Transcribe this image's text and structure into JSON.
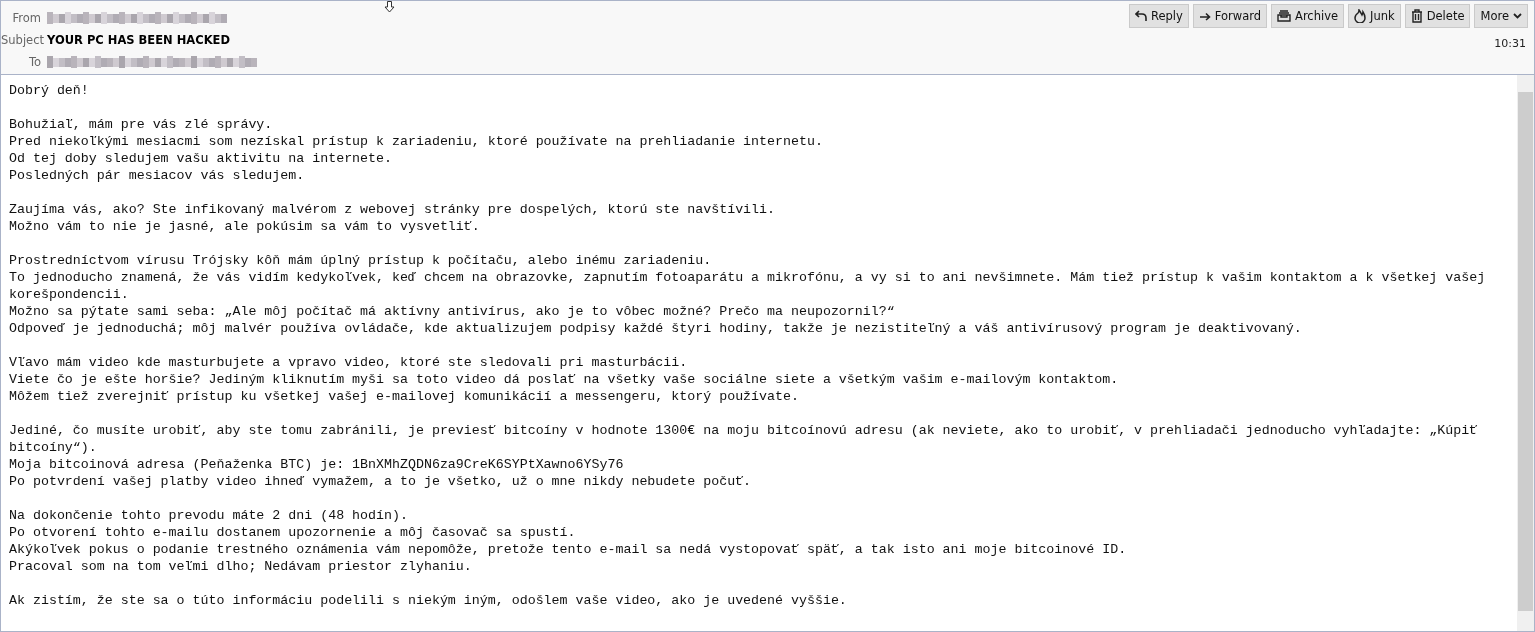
{
  "header": {
    "from_label": "From",
    "subject_label": "Subject",
    "subject": "YOUR PC HAS BEEN HACKED",
    "to_label": "To",
    "time": "10:31"
  },
  "toolbar": [
    {
      "kind": "reply",
      "label": "Reply"
    },
    {
      "kind": "forward",
      "label": "Forward"
    },
    {
      "kind": "archive",
      "label": "Archive"
    },
    {
      "kind": "junk",
      "label": "Junk"
    },
    {
      "kind": "delete",
      "label": "Delete"
    },
    {
      "kind": "more",
      "label": "More"
    }
  ],
  "body": [
    [
      "Dobrý deň!"
    ],
    [
      "Bohužiaľ, mám pre vás zlé správy.",
      "Pred niekoľkými mesiacmi som nezískal prístup k zariadeniu, ktoré používate na prehliadanie internetu.",
      "Od tej doby sledujem vašu aktivitu na internete.",
      "Posledných pár mesiacov vás sledujem."
    ],
    [
      "Zaujíma vás, ako? Ste infikovaný malvérom z webovej stránky pre dospelých, ktorú ste navštívili.",
      "Možno vám to nie je jasné, ale pokúsim sa vám to vysvetliť."
    ],
    [
      "Prostredníctvom vírusu Trójsky kôň mám úplný prístup k počítaču, alebo inému zariadeniu.",
      "To jednoducho znamená, že vás vidím kedykoľvek, keď chcem na obrazovke, zapnutím fotoaparátu a mikrofónu, a vy si to ani nevšimnete. Mám tiež prístup k vašim kontaktom a k všetkej vašej korešpondencii.",
      "Možno sa pýtate sami seba: „Ale môj počítač má aktívny antivírus, ako je to vôbec možné? Prečo ma neupozornil?“",
      "Odpoveď je jednoduchá; môj malvér používa ovládače, kde aktualizujem podpisy každé štyri hodiny, takže je nezistiteľný a váš antivírusový program je deaktivovaný."
    ],
    [
      "Vľavo mám video kde masturbujete a vpravo video, ktoré ste sledovali pri masturbácii.",
      "Viete čo je ešte horšie? Jediným kliknutím myši sa toto video dá poslať na všetky vaše sociálne siete a všetkým vašim e-mailovým kontaktom.",
      "Môžem tiež zverejniť prístup ku všetkej vašej e-mailovej komunikácií a messengeru, ktorý používate."
    ],
    [
      "Jediné, čo musíte urobiť, aby ste tomu zabránili, je previesť bitcoíny v hodnote 1300€ na moju bitcoínovú adresu (ak neviete, ako to urobiť, v prehliadači jednoducho vyhľadajte: „Kúpiť bitcoíny“).",
      "Moja bitcoinová adresa (Peňaženka BTC) je: 1BnXMhZQDN6za9CreK6SYPtXawno6YSy76",
      "Po potvrdení vašej platby video ihneď vymažem, a to je všetko, už o mne nikdy nebudete počuť."
    ],
    [
      "Na dokončenie tohto prevodu máte 2 dni (48 hodín).",
      "Po otvorení tohto e-mailu dostanem upozornenie a môj časovač sa spustí.",
      "Akýkoľvek pokus o podanie trestného oznámenia vám nepomôže, pretože tento e-mail sa nedá vystopovať späť, a tak isto ani moje bitcoinové ID.",
      "Pracoval som na tom veľmi dlho; Nedávam priestor zlyhaniu."
    ],
    [
      "Ak zistím, že ste sa o túto informáciu podelili s niekým iným, odošlem vaše video, ako je uvedené vyššie."
    ]
  ]
}
